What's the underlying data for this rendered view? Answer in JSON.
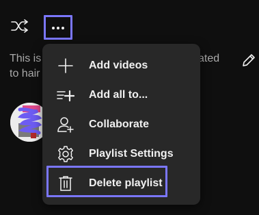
{
  "toolbar": {
    "shuffle_icon": "shuffle-icon",
    "more_icon": "more-horizontal-icon"
  },
  "description": {
    "line1_left": "This is",
    "line1_right": "ated",
    "line2_left": "to hair"
  },
  "edit_icon": "pencil-icon",
  "menu": {
    "items": [
      {
        "label": "Add videos",
        "icon": "plus-icon"
      },
      {
        "label": "Add all to...",
        "icon": "playlist-add-icon"
      },
      {
        "label": "Collaborate",
        "icon": "person-add-icon"
      },
      {
        "label": "Playlist Settings",
        "icon": "gear-icon"
      },
      {
        "label": "Delete playlist",
        "icon": "trash-icon"
      }
    ]
  },
  "colors": {
    "background": "#0f0f0f",
    "menu_bg": "#282828",
    "highlight": "#7b77ff",
    "text": "#f1f1f1",
    "muted_text": "#aaaaaa"
  }
}
